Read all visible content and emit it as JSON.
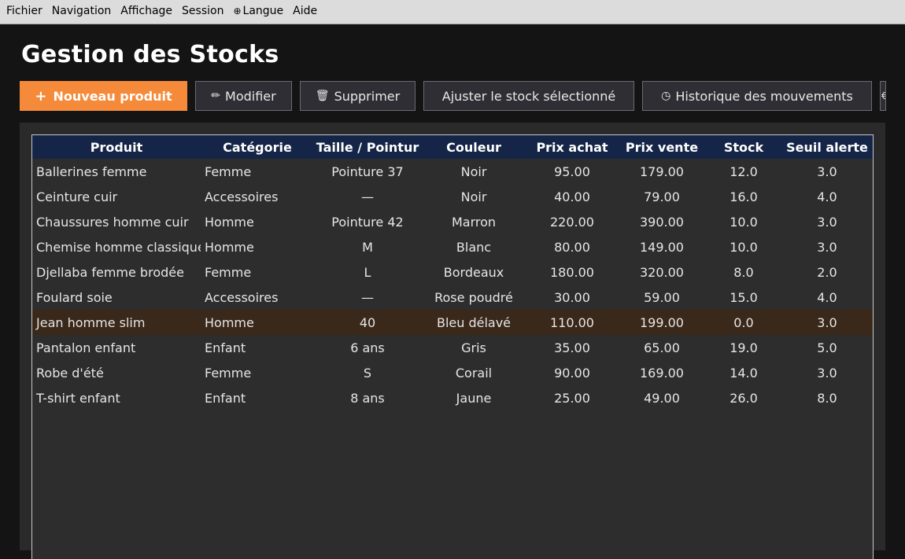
{
  "menu": {
    "items": [
      "Fichier",
      "Navigation",
      "Affichage",
      "Session",
      "Langue",
      "Aide"
    ]
  },
  "page": {
    "title": "Gestion des Stocks"
  },
  "toolbar": {
    "new_label": "Nouveau produit",
    "edit_label": "Modifier",
    "delete_label": "Supprimer",
    "adjust_label": "Ajuster le stock sélectionné",
    "history_label": "Historique des mouvements"
  },
  "colors": {
    "accent": "#f58a3a",
    "header_bg": "#142547",
    "alert_row": "#3a281a"
  },
  "table": {
    "columns": [
      "Produit",
      "Catégorie",
      "Taille / Pointur",
      "Couleur",
      "Prix achat",
      "Prix vente",
      "Stock",
      "Seuil alerte"
    ],
    "rows": [
      {
        "produit": "Ballerines femme",
        "categorie": "Femme",
        "taille": "Pointure 37",
        "couleur": "Noir",
        "prix_achat": "95.00",
        "prix_vente": "179.00",
        "stock": "12.0",
        "seuil": "3.0",
        "alert": false
      },
      {
        "produit": "Ceinture cuir",
        "categorie": "Accessoires",
        "taille": "—",
        "couleur": "Noir",
        "prix_achat": "40.00",
        "prix_vente": "79.00",
        "stock": "16.0",
        "seuil": "4.0",
        "alert": false
      },
      {
        "produit": "Chaussures homme cuir",
        "categorie": "Homme",
        "taille": "Pointure 42",
        "couleur": "Marron",
        "prix_achat": "220.00",
        "prix_vente": "390.00",
        "stock": "10.0",
        "seuil": "3.0",
        "alert": false
      },
      {
        "produit": "Chemise homme classique",
        "categorie": "Homme",
        "taille": "M",
        "couleur": "Blanc",
        "prix_achat": "80.00",
        "prix_vente": "149.00",
        "stock": "10.0",
        "seuil": "3.0",
        "alert": false
      },
      {
        "produit": "Djellaba femme brodée",
        "categorie": "Femme",
        "taille": "L",
        "couleur": "Bordeaux",
        "prix_achat": "180.00",
        "prix_vente": "320.00",
        "stock": "8.0",
        "seuil": "2.0",
        "alert": false
      },
      {
        "produit": "Foulard soie",
        "categorie": "Accessoires",
        "taille": "—",
        "couleur": "Rose poudré",
        "prix_achat": "30.00",
        "prix_vente": "59.00",
        "stock": "15.0",
        "seuil": "4.0",
        "alert": false
      },
      {
        "produit": "Jean homme slim",
        "categorie": "Homme",
        "taille": "40",
        "couleur": "Bleu délavé",
        "prix_achat": "110.00",
        "prix_vente": "199.00",
        "stock": "0.0",
        "seuil": "3.0",
        "alert": true
      },
      {
        "produit": "Pantalon enfant",
        "categorie": "Enfant",
        "taille": "6 ans",
        "couleur": "Gris",
        "prix_achat": "35.00",
        "prix_vente": "65.00",
        "stock": "19.0",
        "seuil": "5.0",
        "alert": false
      },
      {
        "produit": "Robe d'été",
        "categorie": "Femme",
        "taille": "S",
        "couleur": "Corail",
        "prix_achat": "90.00",
        "prix_vente": "169.00",
        "stock": "14.0",
        "seuil": "3.0",
        "alert": false
      },
      {
        "produit": "T-shirt enfant",
        "categorie": "Enfant",
        "taille": "8 ans",
        "couleur": "Jaune",
        "prix_achat": "25.00",
        "prix_vente": "49.00",
        "stock": "26.0",
        "seuil": "8.0",
        "alert": false
      }
    ]
  }
}
